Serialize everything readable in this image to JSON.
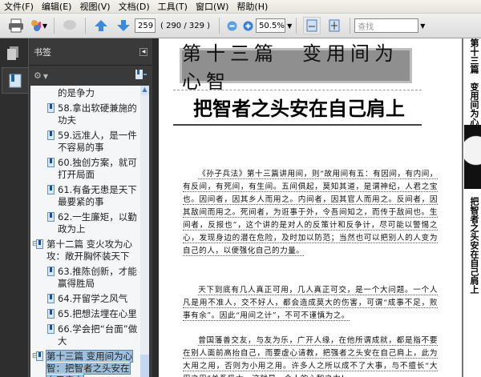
{
  "menu": [
    "文件(F)",
    "编辑(E)",
    "视图(V)",
    "文档(D)",
    "工具(T)",
    "窗口(W)",
    "帮助(H)"
  ],
  "toolbar": {
    "page_input": "259",
    "page_info": "( 290 / 329 )",
    "zoom": "50.5%",
    "search_placeholder": "查找"
  },
  "panel": {
    "title": "书签"
  },
  "bookmarks": [
    {
      "text": "的是争力",
      "level": 2,
      "icon": false
    },
    {
      "text": "58.拿出软硬兼施的功夫",
      "level": 2,
      "icon": true
    },
    {
      "text": "59.远准人，是一件不容易的事",
      "level": 2,
      "icon": true
    },
    {
      "text": "60.独创方案，就可打开局面",
      "level": 2,
      "icon": true
    },
    {
      "text": "61.有备无患是天下最要紧的事",
      "level": 2,
      "icon": true
    },
    {
      "text": "62.一生廉矩，以勤政为上",
      "level": 2,
      "icon": true
    },
    {
      "text": "第十二篇 变火攻为心攻：敞开胸怀装天下",
      "level": 1,
      "icon": true
    },
    {
      "text": "63.推陈创新，才能赢得胜局",
      "level": 2,
      "icon": true
    },
    {
      "text": "64.开留学之风气",
      "level": 2,
      "icon": true
    },
    {
      "text": "65.把想法埋在心里",
      "level": 2,
      "icon": true
    },
    {
      "text": "66.学会把“台面”做大",
      "level": 2,
      "icon": true
    },
    {
      "text": "第十三篇 变用间为心智：把智者之头安在自己肩上",
      "level": 1,
      "icon": true,
      "selected": true
    }
  ],
  "document": {
    "banner": "第十三篇　变用间为心智",
    "title": "把智者之头安在自己肩上",
    "paragraphs": [
      "《孙子兵法》第十三篇讲用间，则“故用间有五：有因间，有内间，有反间，有死间，有生间。五间俱起，莫知其道，是谓神纪，人君之宝也。因间者，因其乡人而用之。内间者，因其官人而用之。反间者，因其敌间而用之。死间者，为诳事于外，令吾间知之，而传于敌间也。生间者，反报也”，这个讲的是对人的反策计和反争计，尽可能以警惕之心，发现身边的潜在危险，及时加以防范；当然也可以把别人的人变为自己的人，以便强化自己的力量。",
      "天下到底有几人真正可用，几人真正可交，是一个大问题。一个人凡是用不准人，交不好人，都会造成莫大的伤害，可谓“成事不足，败事有余”。因此“用间之计”，不可不谨慎为之。",
      "曾国藩善交友，与友为乐，广开人缘，在他所谓成就，都是指不要在别人面前高抬自己，而要虚心请教，把强者之头安在自己肩上，此为大用之用，否则为小用之用。许多人之所以成不了大事，与不擅长“大用之用”关系极大。这就是一个人的心智之力！"
    ],
    "next_page_top": "第十三篇　变用间为心智：",
    "next_page_bottom": "把智者之头安在自己肩上"
  }
}
